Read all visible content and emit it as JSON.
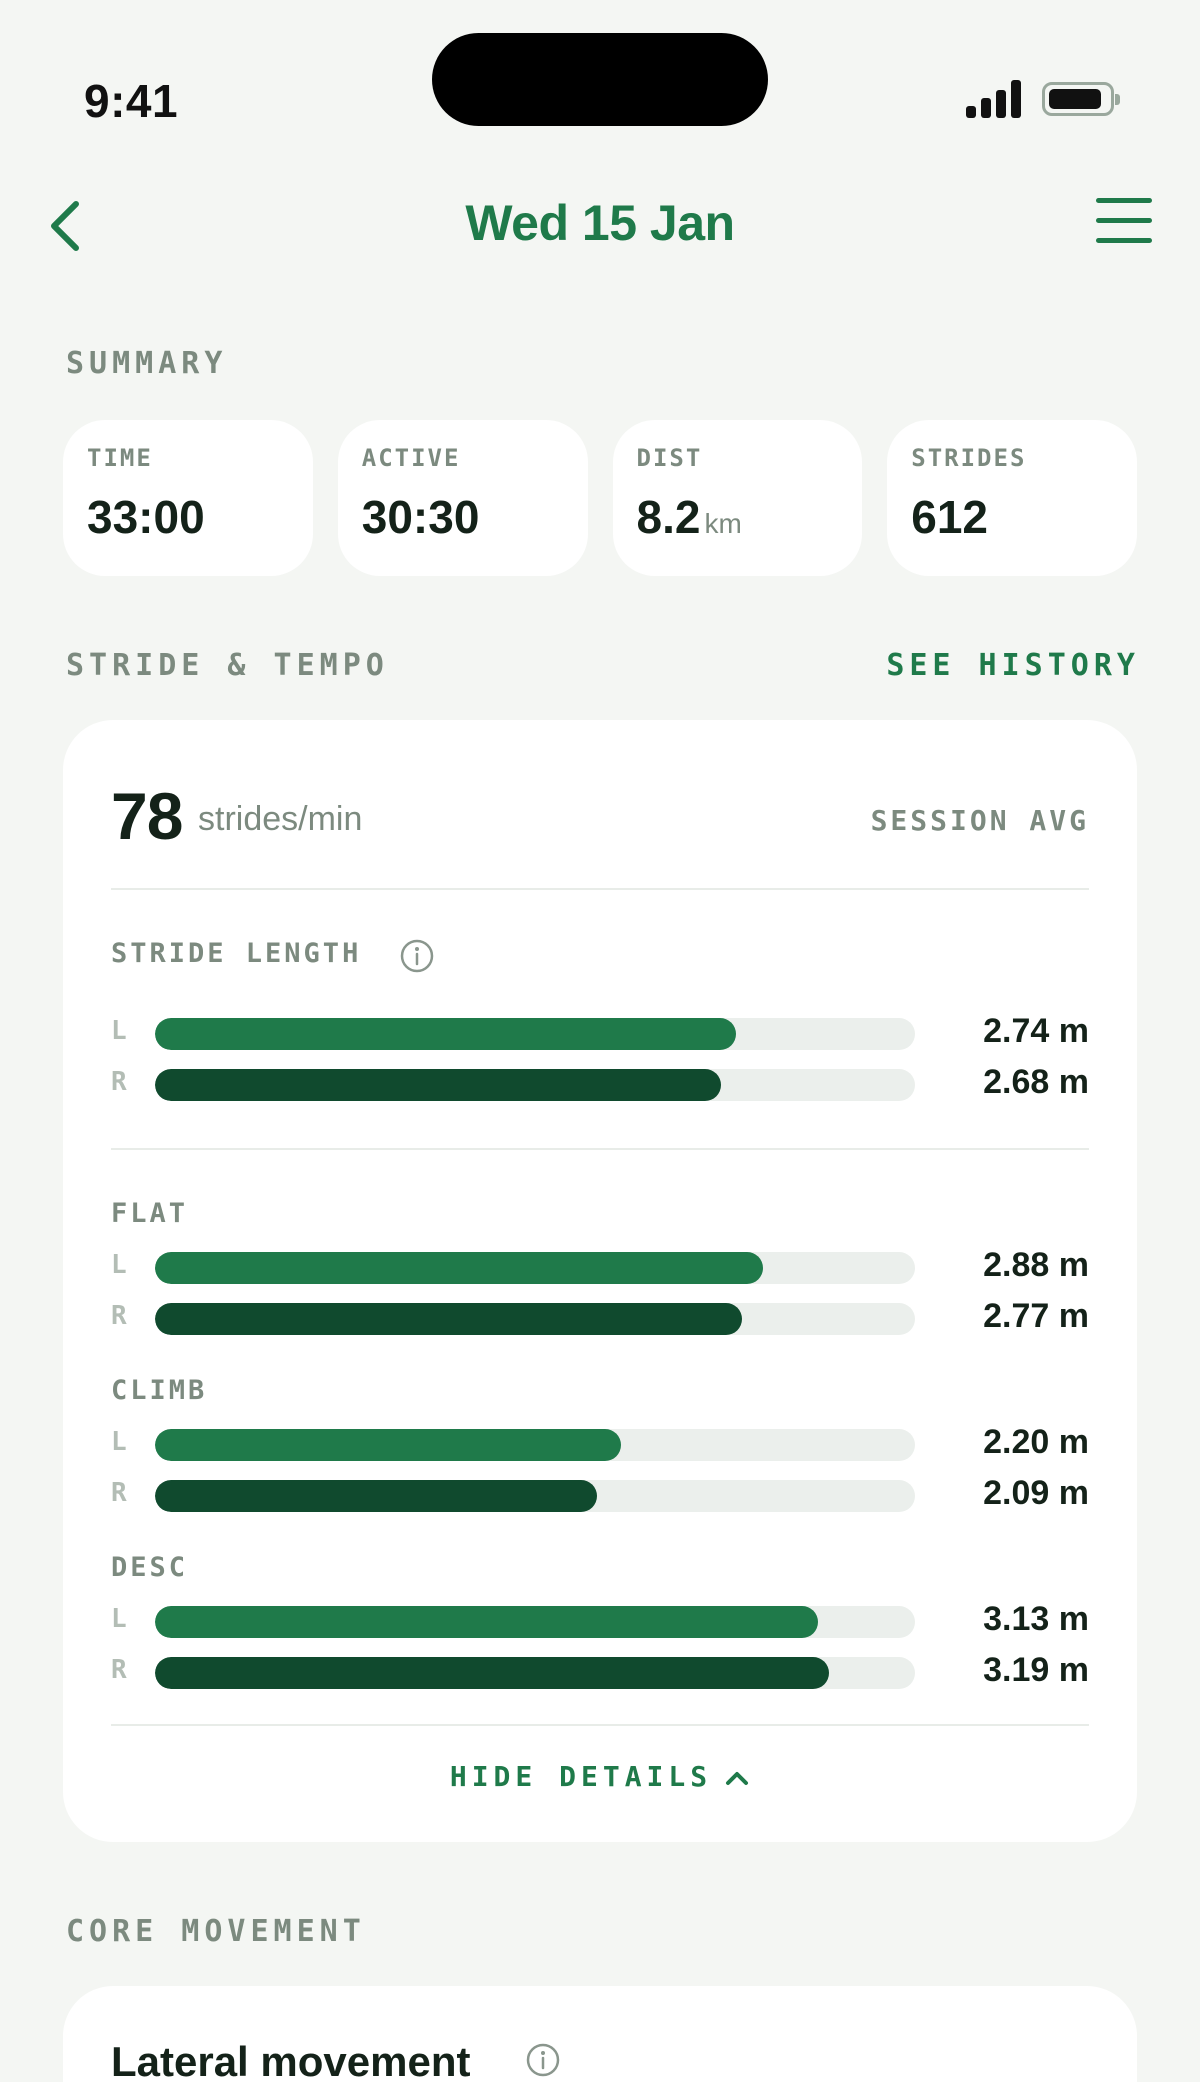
{
  "status_bar": {
    "time": "9:41"
  },
  "nav": {
    "title": "Wed 15 Jan"
  },
  "summary": {
    "label": "SUMMARY",
    "cards": [
      {
        "label": "TIME",
        "value": "33:00",
        "unit": ""
      },
      {
        "label": "ACTIVE",
        "value": "30:30",
        "unit": ""
      },
      {
        "label": "DIST",
        "value": "8.2",
        "unit": "km"
      },
      {
        "label": "STRIDES",
        "value": "612",
        "unit": ""
      }
    ]
  },
  "stride": {
    "section_label": "STRIDE & TEMPO",
    "see_history": "SEE HISTORY",
    "cadence_value": "78",
    "cadence_unit": "strides/min",
    "session_avg": "SESSION AVG",
    "stride_length_label": "STRIDE LENGTH",
    "overall": {
      "l": {
        "side": "L",
        "value": "2.74 m",
        "fraction": 0.765
      },
      "r": {
        "side": "R",
        "value": "2.68 m",
        "fraction": 0.745
      }
    },
    "groups": [
      {
        "label": "FLAT",
        "l": {
          "side": "L",
          "value": "2.88 m",
          "fraction": 0.8
        },
        "r": {
          "side": "R",
          "value": "2.77 m",
          "fraction": 0.772
        }
      },
      {
        "label": "CLIMB",
        "l": {
          "side": "L",
          "value": "2.20 m",
          "fraction": 0.613
        },
        "r": {
          "side": "R",
          "value": "2.09 m",
          "fraction": 0.582
        }
      },
      {
        "label": "DESC",
        "l": {
          "side": "L",
          "value": "3.13 m",
          "fraction": 0.872
        },
        "r": {
          "side": "R",
          "value": "3.19 m",
          "fraction": 0.887
        }
      }
    ],
    "hide_details": "HIDE DETAILS"
  },
  "core": {
    "section_label": "CORE MOVEMENT",
    "lateral_title": "Lateral movement"
  },
  "colors": {
    "accent": "#1f7a4a",
    "accent_dark": "#104a2e",
    "background": "#f4f6f3"
  }
}
